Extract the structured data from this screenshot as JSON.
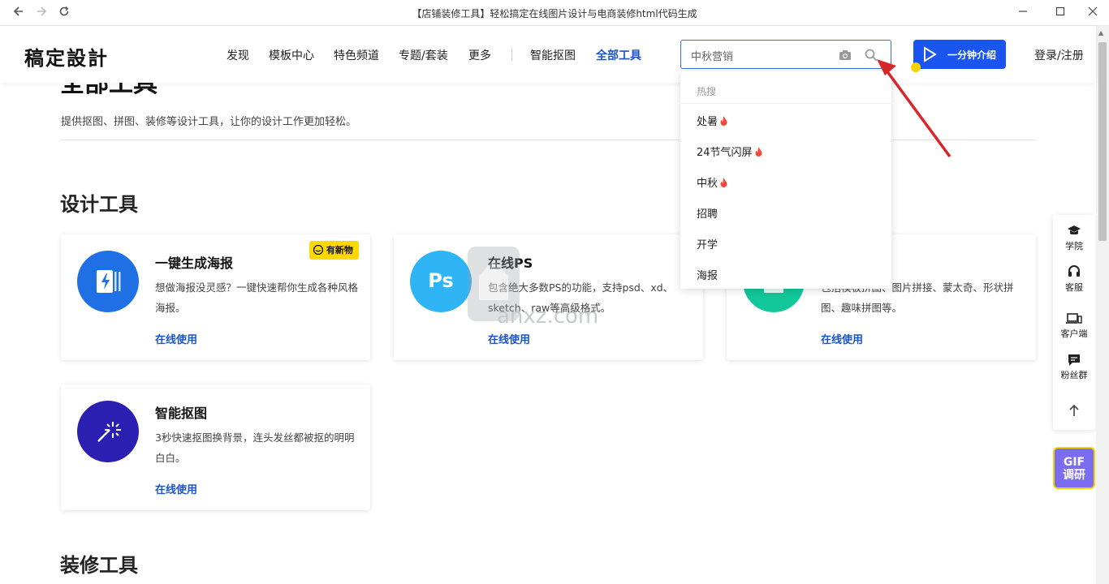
{
  "window": {
    "title": "【店铺装修工具】轻松搞定在线图片设计与电商装修html代码生成"
  },
  "header": {
    "logo": "稿定設計",
    "nav": [
      "发现",
      "模板中心",
      "特色频道",
      "专题/套装",
      "更多",
      "智能抠图",
      "全部工具"
    ],
    "active_nav": "全部工具",
    "search_value": "中秋营销",
    "intro_button": "一分钟介绍",
    "login": "登录/注册"
  },
  "dropdown": {
    "heading": "热搜",
    "items": [
      {
        "label": "处暑",
        "hot": true
      },
      {
        "label": "24节气闪屏",
        "hot": true
      },
      {
        "label": "中秋",
        "hot": true
      },
      {
        "label": "招聘",
        "hot": false
      },
      {
        "label": "开学",
        "hot": false
      },
      {
        "label": "海报",
        "hot": false
      }
    ]
  },
  "page": {
    "title": "全部工具",
    "description": "提供抠图、拼图、装修等设计工具，让你的设计工作更加轻松。"
  },
  "sections": {
    "design": "设计工具",
    "decor": "装修工具"
  },
  "cards": [
    {
      "title": "一键生成海报",
      "desc": "想做海报没灵感？一键快速帮你生成各种风格海报。",
      "link": "在线使用",
      "badge": "有新物",
      "color": "#1f6fe5"
    },
    {
      "title": "在线PS",
      "desc": "包含绝大多数PS的功能，支持psd、xd、sketch、raw等高级格式。",
      "link": "在线使用",
      "color": "#2fb4f5",
      "icon_text": "Ps"
    },
    {
      "title": "",
      "desc": "包括模板拼图、图片拼接、蒙太奇、形状拼图、趣味拼图等。",
      "link": "在线使用",
      "color": "#12c79a"
    },
    {
      "title": "智能抠图",
      "desc": "3秒快速抠图换背景，连头发丝都被抠的明明白白。",
      "link": "在线使用",
      "color": "#2a1fb0"
    }
  ],
  "sidebar": {
    "items": [
      "学院",
      "客服",
      "客户端",
      "粉丝群"
    ],
    "gif": [
      "GIF",
      "调研"
    ]
  },
  "watermark": "anxz.com",
  "icons": {
    "back": "back-arrow-icon",
    "forward": "forward-arrow-icon",
    "reload": "reload-icon",
    "camera": "camera-icon",
    "search": "search-icon",
    "fire": "fire-icon"
  }
}
